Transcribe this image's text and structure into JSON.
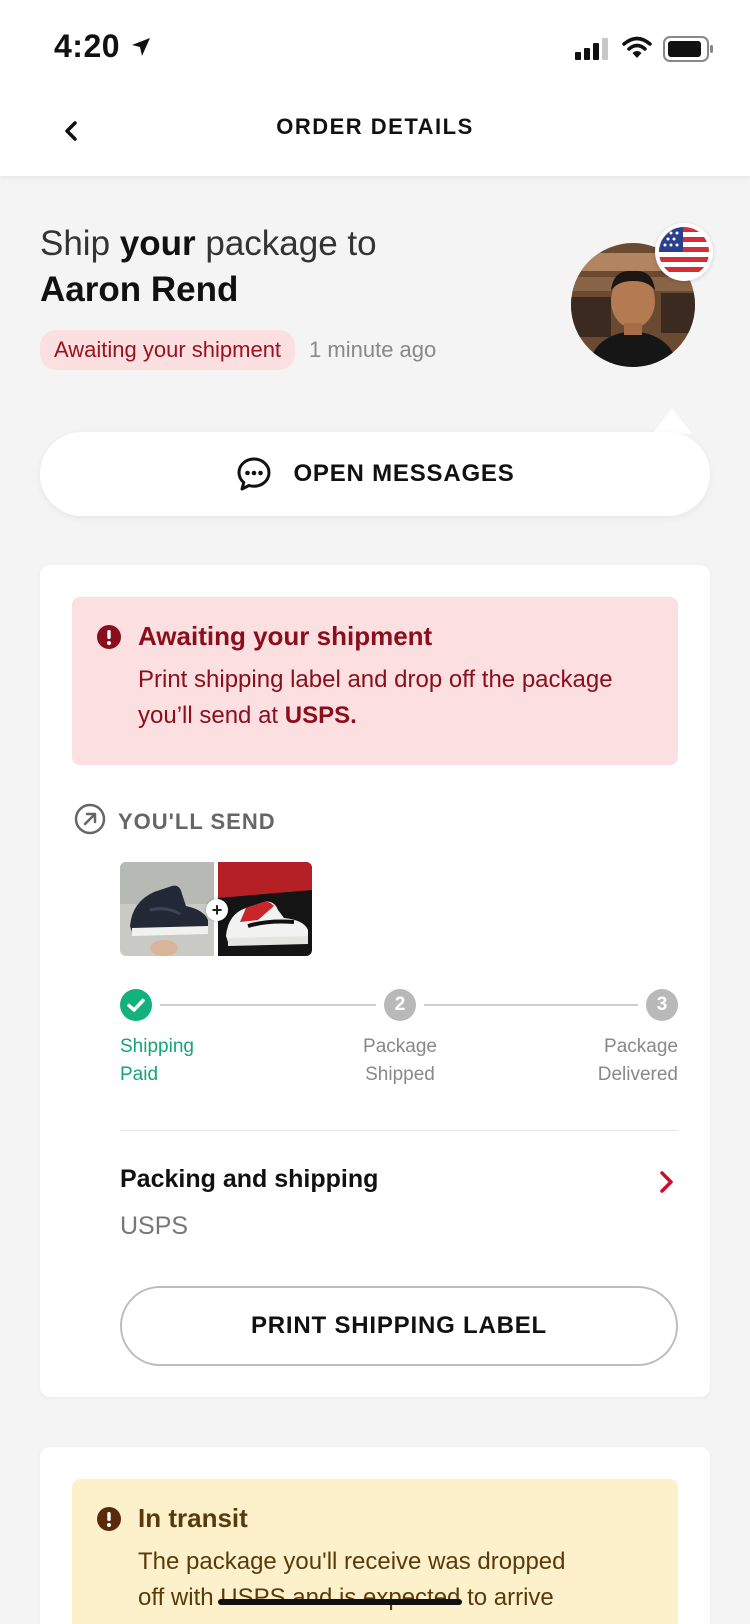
{
  "status_bar": {
    "time": "4:20",
    "location_icon": "location-arrow-icon",
    "signal_icon": "cellular-signal-icon",
    "wifi_icon": "wifi-icon",
    "battery_icon": "battery-icon"
  },
  "nav": {
    "title": "ORDER DETAILS",
    "back_icon": "chevron-left-icon"
  },
  "header": {
    "ship_prefix": "Ship ",
    "ship_bold": "your",
    "ship_suffix": " package to",
    "recipient": "Aaron Rend",
    "status": "Awaiting your shipment",
    "time_ago": "1 minute ago",
    "flag_icon": "us-flag-icon"
  },
  "messages": {
    "label": "OPEN MESSAGES",
    "icon": "chat-bubble-icon"
  },
  "order_card": {
    "alert": {
      "title": "Awaiting your shipment",
      "body_prefix": "Print shipping label and drop off the package you’ll send at ",
      "body_bold": "USPS."
    },
    "send_label": "YOU'LL SEND",
    "plus": "+",
    "steps": [
      {
        "line1": "Shipping",
        "line2": "Paid",
        "marker": ""
      },
      {
        "line1": "Package",
        "line2": "Shipped",
        "marker": "2"
      },
      {
        "line1": "Package",
        "line2": "Delivered",
        "marker": "3"
      }
    ],
    "packing_title": "Packing and shipping",
    "packing_carrier": "USPS",
    "print_button": "PRINT SHIPPING LABEL"
  },
  "transit_card": {
    "title": "In transit",
    "body_line1": "The package you'll receive was dropped",
    "body_prefix": "off with ",
    "body_redacted": "USPS and is expected",
    "body_suffix": " to arrive"
  },
  "colors": {
    "alert_red_bg": "#fbdfe1",
    "alert_red_text": "#8a0e1c",
    "alert_yellow_bg": "#fdf1cc",
    "success_green": "#13b27a",
    "chevron_red": "#c8102e"
  }
}
